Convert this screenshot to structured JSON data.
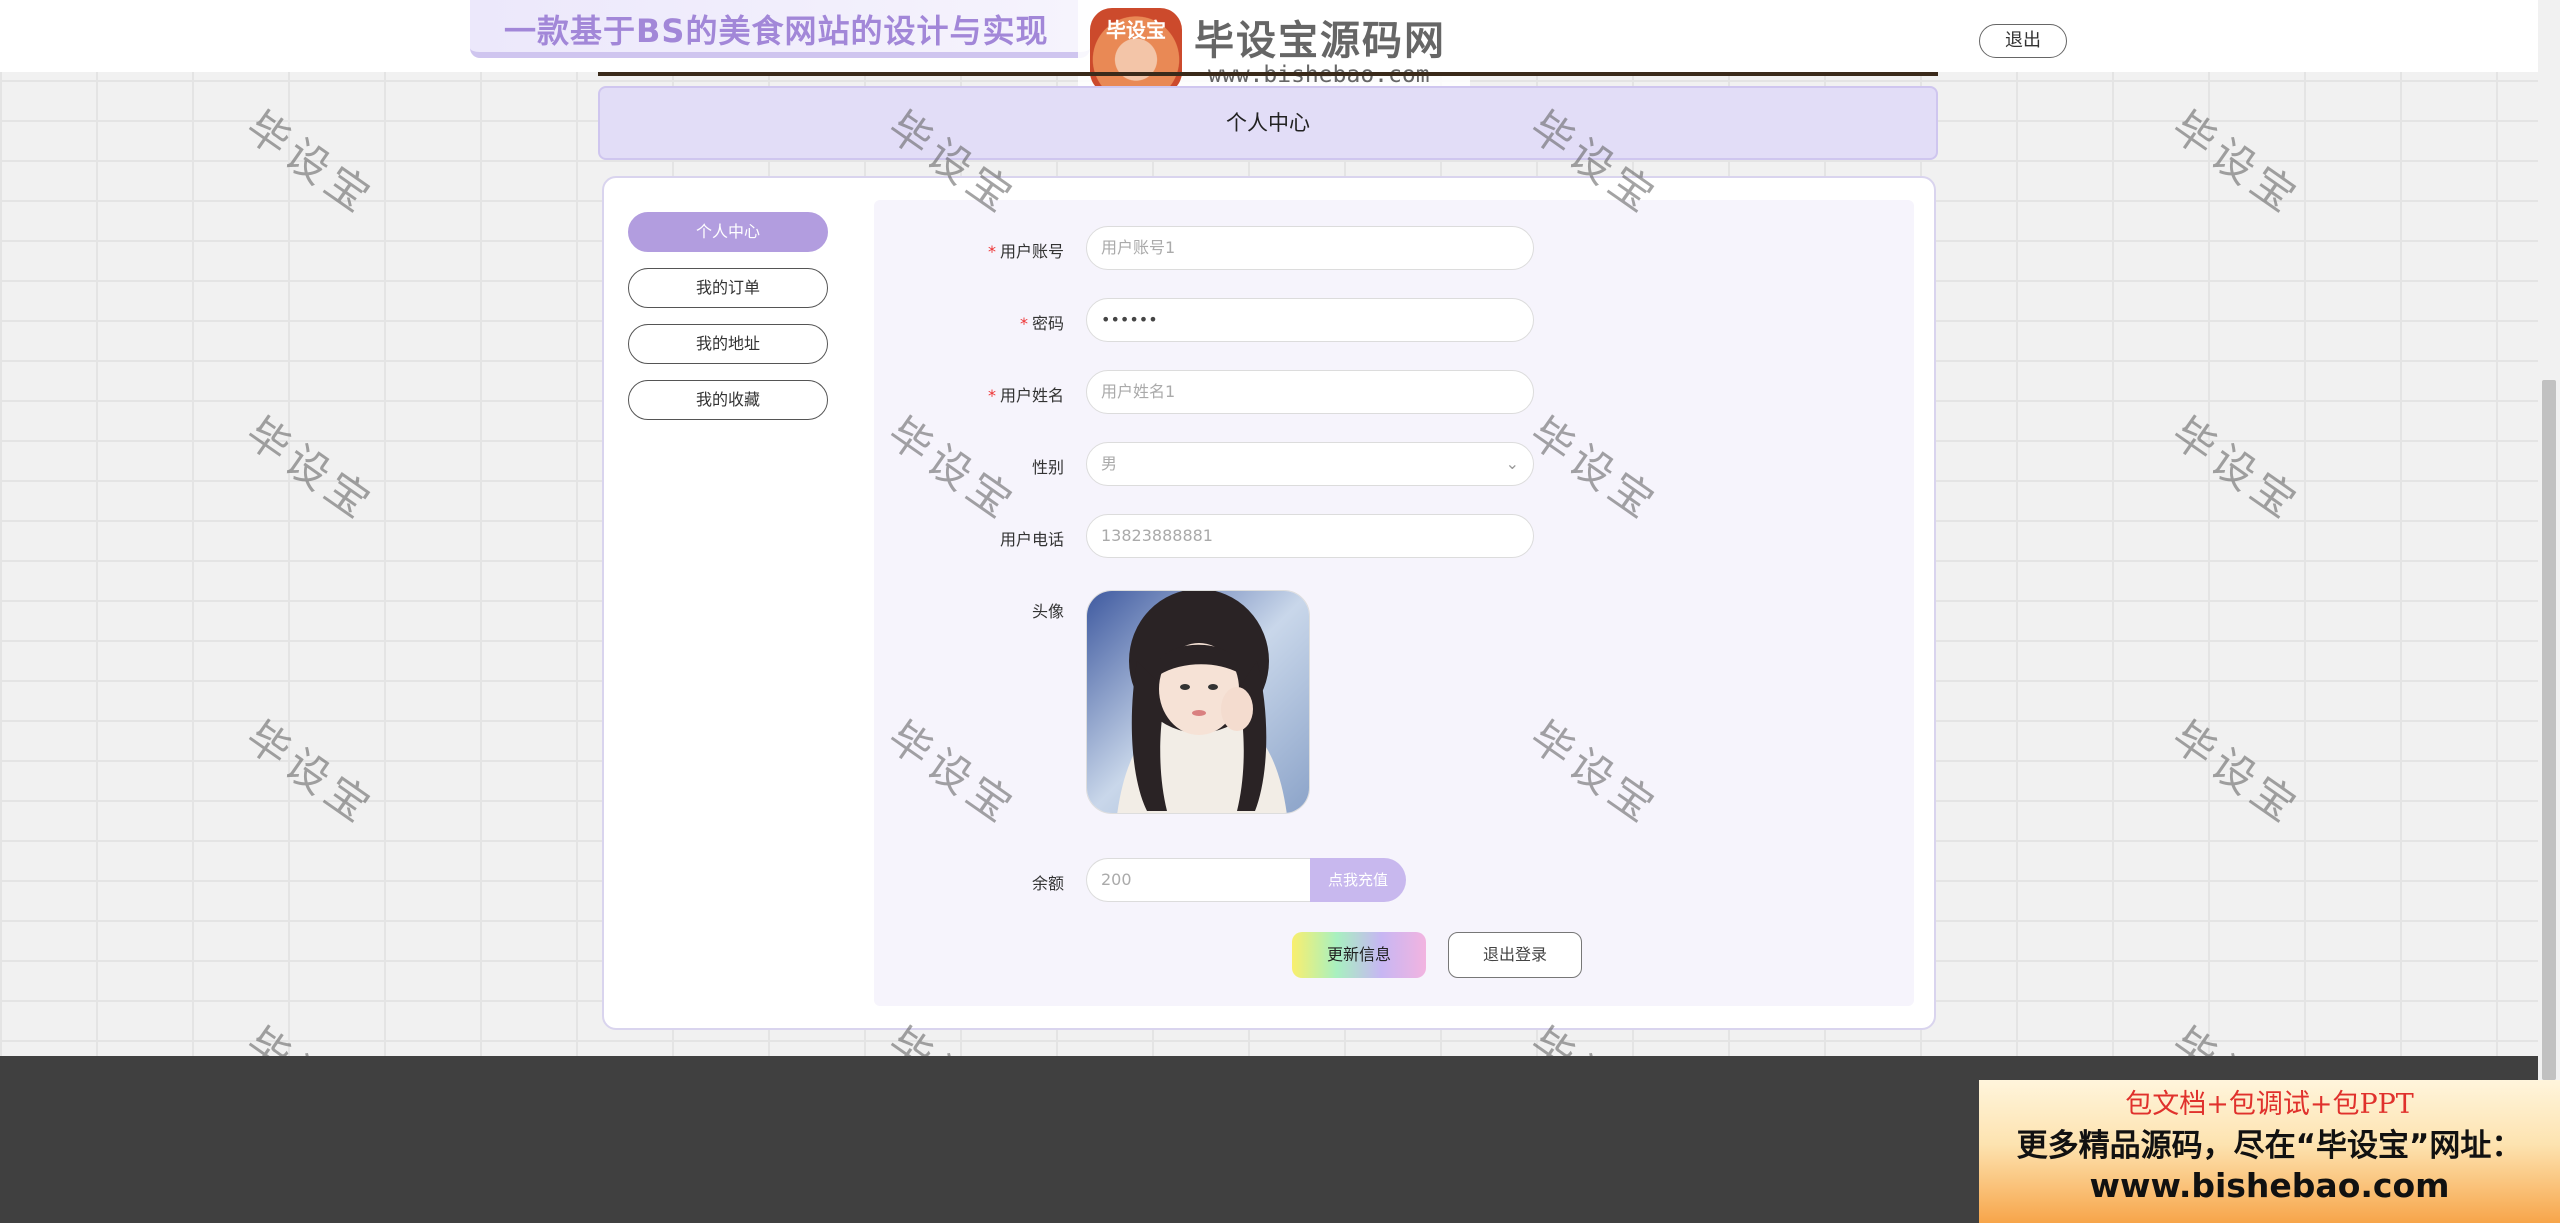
{
  "header": {
    "site_title": "一款基于BS的美食网站的设计与实现",
    "logo_badge": "毕设宝",
    "logo_text": "毕设宝源码网",
    "logo_url": "www.bishebao.com",
    "logout_label": "退出"
  },
  "page_title": "个人中心",
  "sidebar": {
    "items": [
      {
        "label": "个人中心",
        "active": true
      },
      {
        "label": "我的订单",
        "active": false
      },
      {
        "label": "我的地址",
        "active": false
      },
      {
        "label": "我的收藏",
        "active": false
      }
    ]
  },
  "form": {
    "account": {
      "label": "用户账号",
      "required": "*",
      "placeholder": "用户账号1"
    },
    "password": {
      "label": "密码",
      "required": "*",
      "value": "••••••"
    },
    "name": {
      "label": "用户姓名",
      "required": "*",
      "placeholder": "用户姓名1"
    },
    "gender": {
      "label": "性别",
      "value": "男"
    },
    "phone": {
      "label": "用户电话",
      "value": "13823888881"
    },
    "avatar": {
      "label": "头像"
    },
    "balance": {
      "label": "余额",
      "value": "200",
      "recharge_label": "点我充值"
    },
    "update_label": "更新信息",
    "logout_label": "退出登录"
  },
  "watermark": "毕设宝",
  "ad": {
    "line1": "包文档+包调试+包PPT",
    "line2": "更多精品源码，尽在“毕设宝”网址：",
    "line3": "www.bishebao.com"
  },
  "colors": {
    "accent": "#b29ddf",
    "header_panel": "#e2ddf7",
    "required": "#ee3333",
    "footer": "#404040"
  }
}
